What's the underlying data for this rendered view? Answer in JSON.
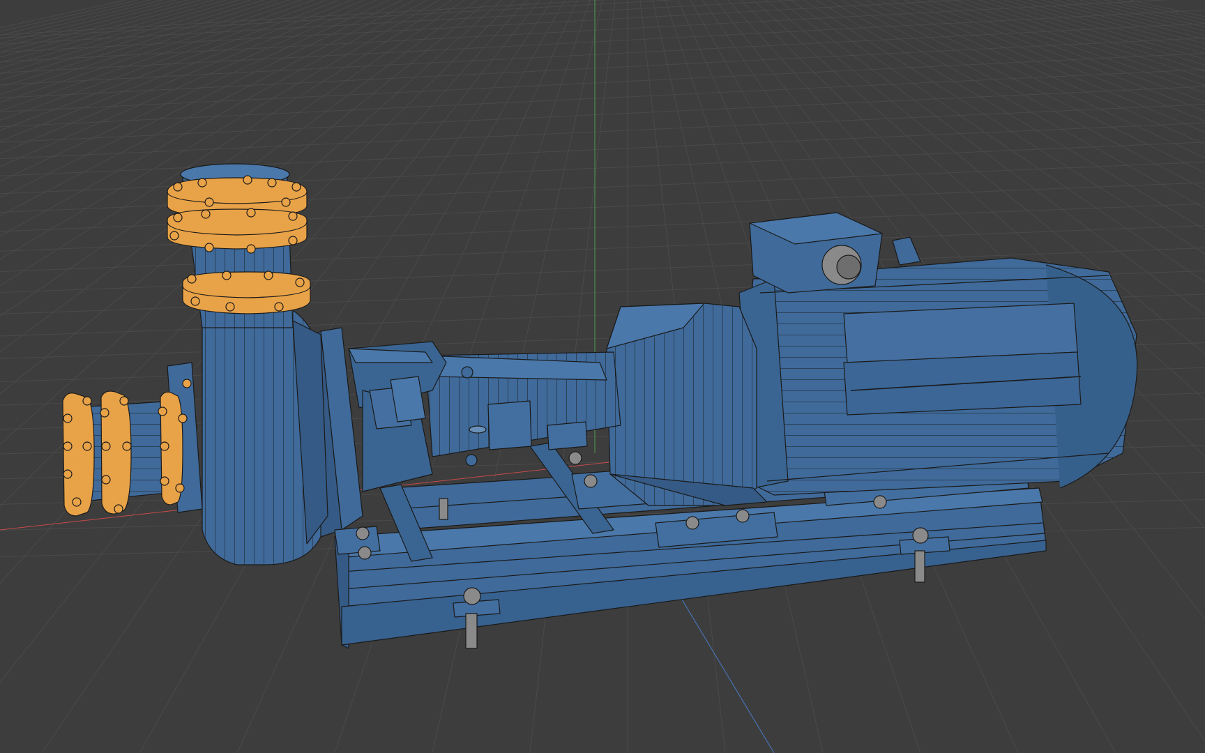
{
  "viewport": {
    "background": "#3d3d3d",
    "grid_color": "#4a4a4a",
    "axis_x_color": "#c84a4a",
    "axis_y_color": "#4a9a4a",
    "axis_z_color": "#4a7ac8"
  },
  "model": {
    "body_color": "#3f6a9a",
    "flange_color": "#e8a247",
    "bolt_color": "#8a8a8a",
    "wire_color": "#1a1a1a",
    "parts": [
      "pump-casing",
      "discharge-pipe",
      "suction-pipe",
      "bearing-housing",
      "motor",
      "terminal-box",
      "base-frame",
      "mounting-bolts"
    ]
  }
}
